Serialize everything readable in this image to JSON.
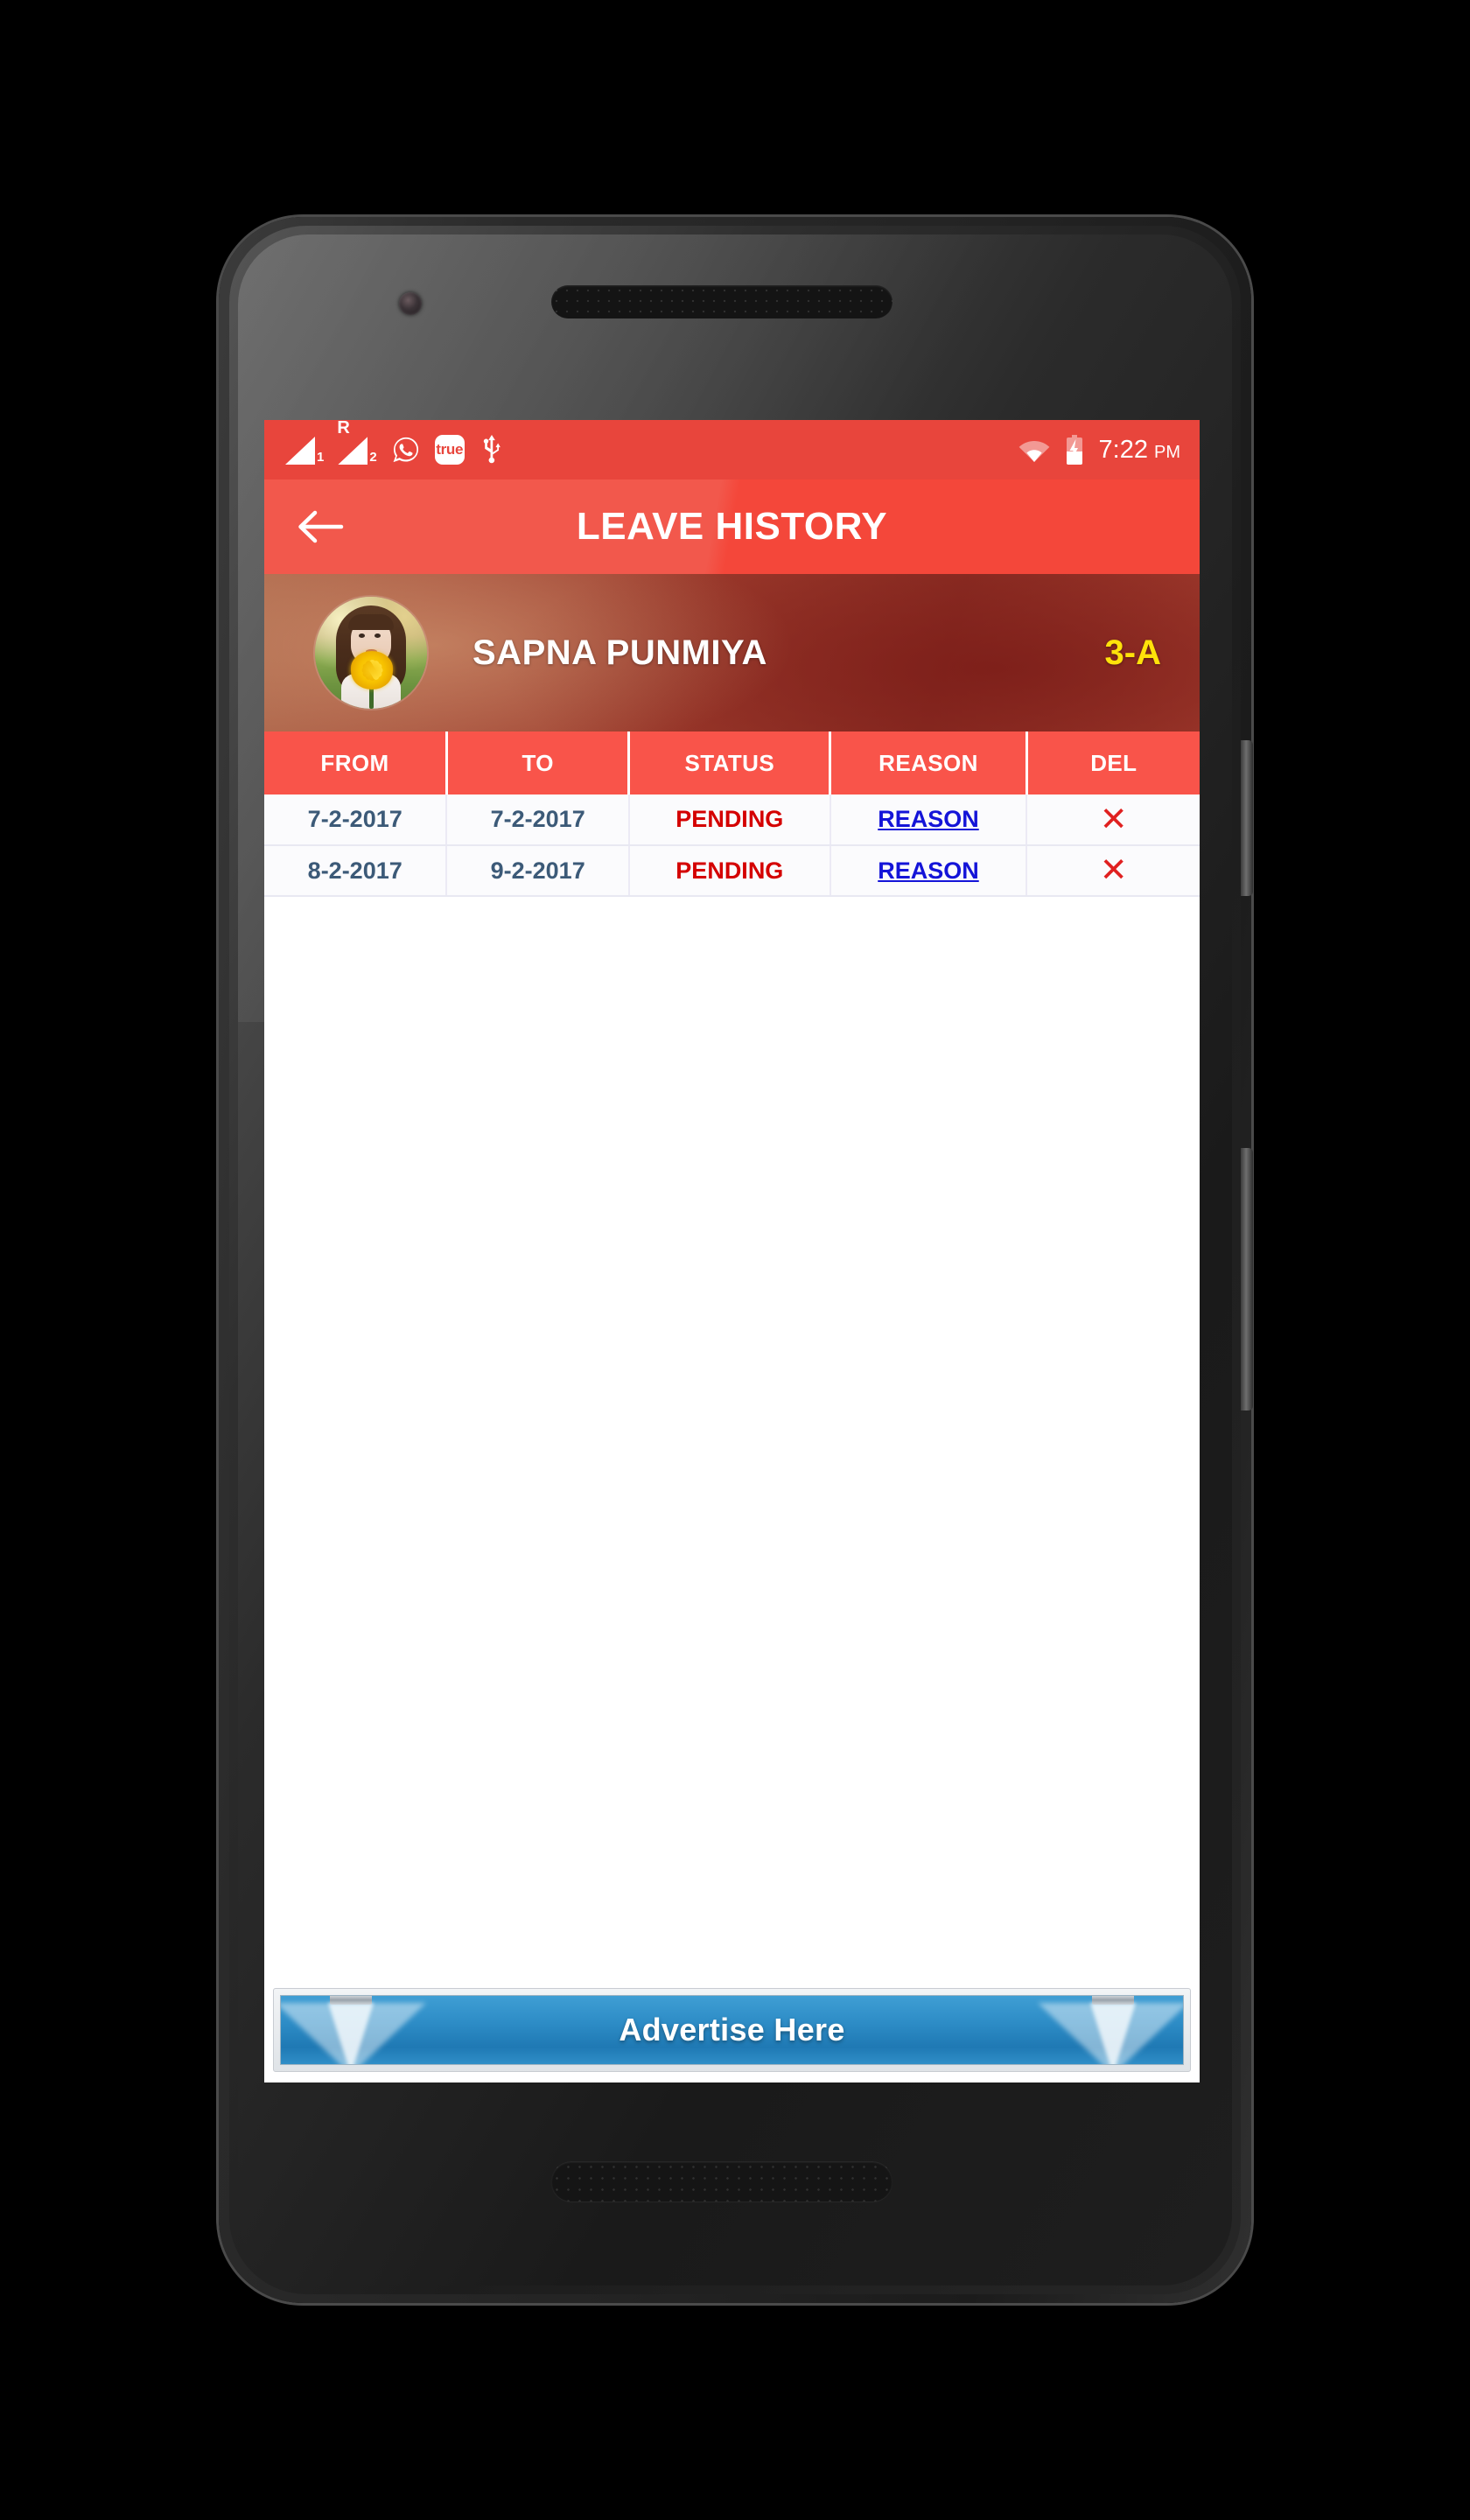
{
  "status_bar": {
    "signal_1": {
      "icon": "signal-bars-icon",
      "label": "1"
    },
    "signal_2": {
      "icon": "signal-bars-icon",
      "label": "2",
      "roaming": "R"
    },
    "whatsapp": {
      "icon": "whatsapp-icon"
    },
    "truecaller": {
      "icon": "truecaller-icon",
      "label": "true"
    },
    "usb": {
      "icon": "usb-icon"
    },
    "wifi": {
      "icon": "wifi-icon"
    },
    "battery": {
      "icon": "battery-charging-icon"
    },
    "time": "7:22",
    "ampm": "PM"
  },
  "app_bar": {
    "back_icon": "arrow-left-icon",
    "title": "LEAVE HISTORY"
  },
  "profile": {
    "avatar_icon": "user-avatar-photo",
    "name": "SAPNA PUNMIYA",
    "class": "3-A"
  },
  "table": {
    "columns": [
      "FROM",
      "TO",
      "STATUS",
      "REASON",
      "DEL"
    ],
    "rows": [
      {
        "from": "7-2-2017",
        "to": "7-2-2017",
        "status": "PENDING",
        "reason": "REASON",
        "del": "✕"
      },
      {
        "from": "8-2-2017",
        "to": "9-2-2017",
        "status": "PENDING",
        "reason": "REASON",
        "del": "✕"
      }
    ]
  },
  "ad": {
    "text": "Advertise Here"
  },
  "colors": {
    "status_bar_red": "#e8453c",
    "app_bar_red": "#f4473a",
    "table_header_red": "#f9544a",
    "date_blue": "#3c5a78",
    "status_red": "#d40000",
    "link_blue": "#1414d8",
    "class_yellow": "#ffe20a",
    "ad_blue": "#2d8cc6"
  }
}
